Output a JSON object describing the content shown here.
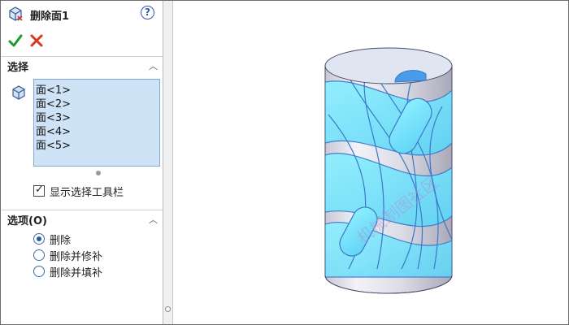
{
  "header": {
    "title": "删除面1",
    "help_symbol": "?"
  },
  "actions": {
    "ok_label": "✔",
    "cancel_label": "✖"
  },
  "selection": {
    "title": "选择",
    "faces": [
      "面<1>",
      "面<2>",
      "面<3>",
      "面<4>",
      "面<5>"
    ],
    "show_toolbar_label": "显示选择工具栏",
    "show_toolbar_checked": true
  },
  "options": {
    "title": "选项(O)",
    "choices": [
      "删除",
      "删除并修补",
      "删除并填补"
    ],
    "selected": "删除"
  },
  "watermark": "机械制图社区",
  "colors": {
    "accent_blue": "#2b58a8",
    "list_bg": "#cfe3f7",
    "face_cyan": "#7fe3ff"
  }
}
